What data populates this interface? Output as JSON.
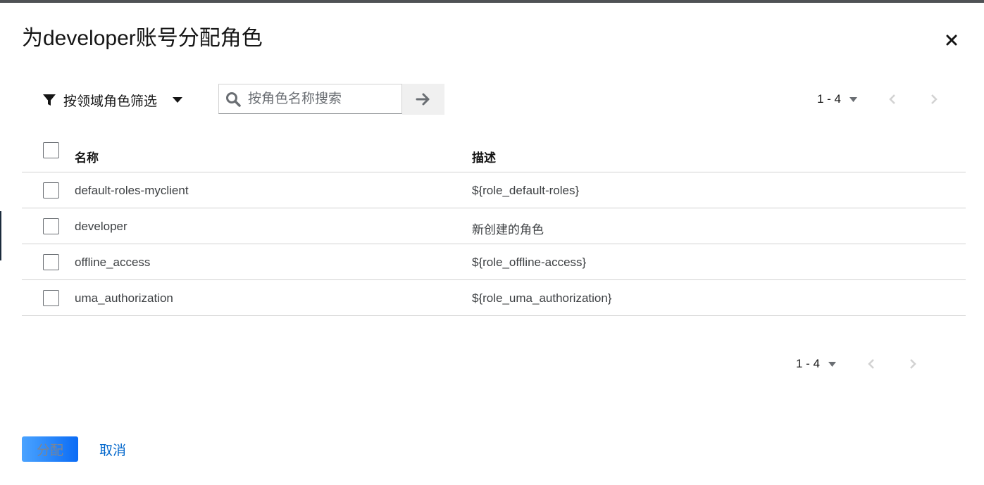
{
  "dialog": {
    "title": "为developer账号分配角色"
  },
  "toolbar": {
    "filter_label": "按领域角色筛选",
    "search_placeholder": "按角色名称搜索"
  },
  "pagination": {
    "range": "1 - 4"
  },
  "table": {
    "columns": [
      "名称",
      "描述"
    ],
    "rows": [
      {
        "name": "default-roles-myclient",
        "description": "${role_default-roles}"
      },
      {
        "name": "developer",
        "description": "新创建的角色"
      },
      {
        "name": "offline_access",
        "description": "${role_offline-access}"
      },
      {
        "name": "uma_authorization",
        "description": "${role_uma_authorization}"
      }
    ]
  },
  "footer": {
    "assign_label": "分配",
    "cancel_label": "取消"
  },
  "icons": {
    "close": "close-icon",
    "filter": "filter-icon",
    "search": "search-icon",
    "arrow": "arrow-right-icon",
    "caret": "caret-down-icon",
    "prev": "chevron-left-icon",
    "next": "chevron-right-icon"
  },
  "colors": {
    "primary": "#0066cc",
    "border": "#d2d2d2",
    "disabled_icon": "#d2d2d2"
  }
}
